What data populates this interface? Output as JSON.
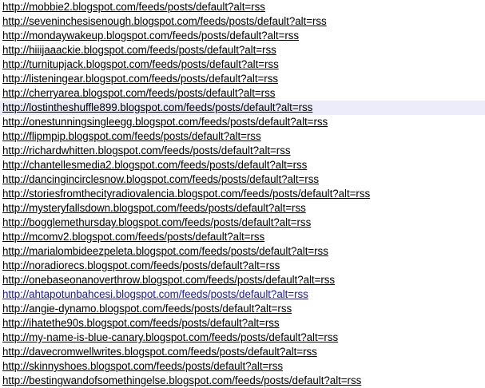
{
  "feeds": {
    "highlight_color": "#ececfa",
    "visited_link_color": "#1a1aa6",
    "highlighted_index": 7,
    "visited_index": 20,
    "items": [
      "http://mobbie2.blogspot.com/feeds/posts/default?alt=rss",
      "http://seveninchesisenough.blogspot.com/feeds/posts/default?alt=rss",
      "http://mondaywakeup.blogspot.com/feeds/posts/default?alt=rss",
      "http://hiiijaaackie.blogspot.com/feeds/posts/default?alt=rss",
      "http://turnitupjack.blogspot.com/feeds/posts/default?alt=rss",
      "http://listeningear.blogspot.com/feeds/posts/default?alt=rss",
      "http://cherryarea.blogspot.com/feeds/posts/default?alt=rss",
      "http://lostintheshuffle899.blogspot.com/feeds/posts/default?alt=rss",
      "http://onestunningsingleegg.blogspot.com/feeds/posts/default?alt=rss",
      "http://flipmpip.blogspot.com/feeds/posts/default?alt=rss",
      "http://richardwhitten.blogspot.com/feeds/posts/default?alt=rss",
      "http://chantellesmedia2.blogspot.com/feeds/posts/default?alt=rss",
      "http://dancingincirclesnow.blogspot.com/feeds/posts/default?alt=rss",
      "http://storiesfromthecityradiovalencia.blogspot.com/feeds/posts/default?alt=rss",
      "http://mysteryfallsdown.blogspot.com/feeds/posts/default?alt=rss",
      "http://bogglemethursday.blogspot.com/feeds/posts/default?alt=rss",
      "http://mcomv2.blogspot.com/feeds/posts/default?alt=rss",
      "http://marialombideezpeleta.blogspot.com/feeds/posts/default?alt=rss",
      "http://noradiorecs.blogspot.com/feeds/posts/default?alt=rss",
      "http://onebaseonanoverthrow.blogspot.com/feeds/posts/default?alt=rss",
      "http://ahtapotunbahcesi.blogspot.com/feeds/posts/default?alt=rss",
      "http://angie-dynamo.blogspot.com/feeds/posts/default?alt=rss",
      "http://ihatethe90s.blogspot.com/feeds/posts/default?alt=rss",
      "http://my-name-is-blue-canary.blogspot.com/feeds/posts/default?alt=rss",
      "http://davecromwellwrites.blogspot.com/feeds/posts/default?alt=rss",
      "http://skinnyshoes.blogspot.com/feeds/posts/default?alt=rss",
      "http://bestingwandofsomethingelse.blogspot.com/feeds/posts/default?alt=rss"
    ]
  }
}
